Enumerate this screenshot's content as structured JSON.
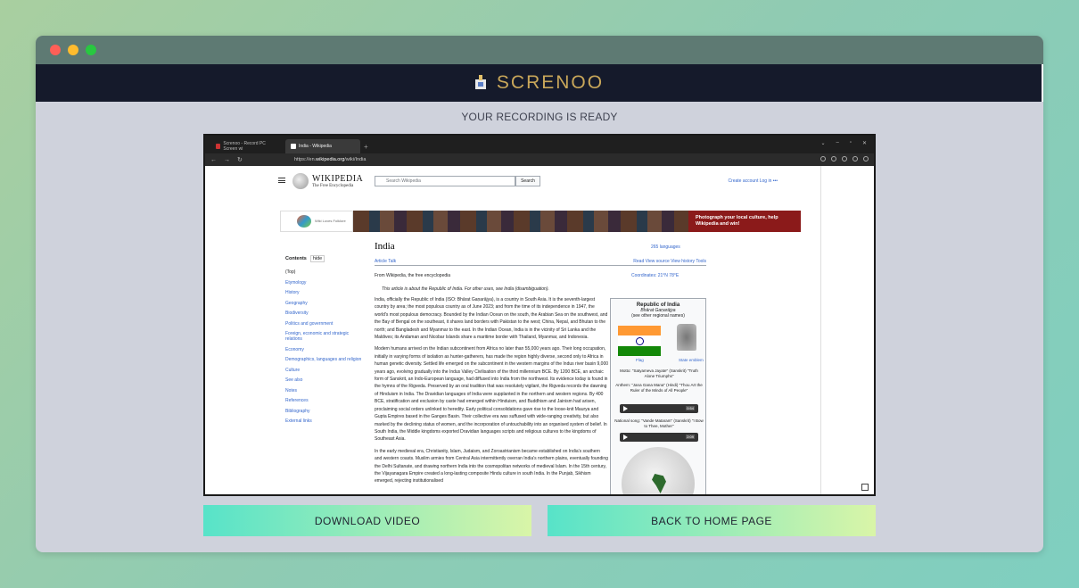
{
  "app": {
    "brand": "SCRENOO",
    "heading": "YOUR RECORDING IS READY"
  },
  "browser": {
    "tabs": [
      {
        "title": "Screnoo - Record PC Screen wi"
      },
      {
        "title": "India - Wikipedia"
      }
    ],
    "new_tab": "+",
    "url_prefix": "https://en.",
    "url_domain": "wikipedia.org",
    "url_path": "/wiki/India"
  },
  "wiki": {
    "logo_title": "WIKIPEDIA",
    "logo_sub": "The Free Encyclopedia",
    "search_placeholder": "Search Wikipedia",
    "search_button": "Search",
    "account": "Create account  Log in  •••",
    "banner_text": "Photograph your local culture, help Wikipedia and win!",
    "banner_logo_text": "Wiki Loves Folklore",
    "toc_title": "Contents",
    "toc_hide": "hide",
    "toc_items": [
      "(Top)",
      "Etymology",
      "History",
      "Geography",
      "Biodiversity",
      "Politics and government",
      "Foreign, economic and strategic relations",
      "Economy",
      "Demographics, languages and religion",
      "Culture",
      "See also",
      "Notes",
      "References",
      "Bibliography",
      "External links"
    ],
    "article_title": "India",
    "languages": "265 languages",
    "tabs_left": "Article   Talk",
    "tabs_right": "Read   View source   View history   Tools",
    "from": "From Wikipedia, the free encyclopedia",
    "coordinates": "Coordinates: 21°N 78°E",
    "hatnote": "This article is about the Republic of India. For other uses, see India (disambiguation).",
    "paragraphs": [
      "India, officially the Republic of India (ISO: Bhārat Gaṇarājya), is a country in South Asia. It is the seventh-largest country by area; the most populous country as of June 2023; and from the time of its independence in 1947, the world's most populous democracy. Bounded by the Indian Ocean on the south, the Arabian Sea on the southwest, and the Bay of Bengal on the southeast, it shares land borders with Pakistan to the west; China, Nepal, and Bhutan to the north; and Bangladesh and Myanmar to the east. In the Indian Ocean, India is in the vicinity of Sri Lanka and the Maldives; its Andaman and Nicobar Islands share a maritime border with Thailand, Myanmar, and Indonesia.",
      "Modern humans arrived on the Indian subcontinent from Africa no later than 55,000 years ago. Their long occupation, initially in varying forms of isolation as hunter-gatherers, has made the region highly diverse, second only to Africa in human genetic diversity. Settled life emerged on the subcontinent in the western margins of the Indus river basin 9,000 years ago, evolving gradually into the Indus Valley Civilisation of the third millennium BCE. By 1200 BCE, an archaic form of Sanskrit, an Indo-European language, had diffused into India from the northwest. Its evidence today is found in the hymns of the Rigveda. Preserved by an oral tradition that was resolutely vigilant, the Rigveda records the dawning of Hinduism in India. The Dravidian languages of India were supplanted in the northern and western regions. By 400 BCE, stratification and exclusion by caste had emerged within Hinduism, and Buddhism and Jainism had arisen, proclaiming social orders unlinked to heredity. Early political consolidations gave rise to the loose-knit Maurya and Gupta Empires based in the Ganges Basin. Their collective era was suffused with wide-ranging creativity, but also marked by the declining status of women, and the incorporation of untouchability into an organised system of belief. In South India, the Middle kingdoms exported Dravidian languages scripts and religious cultures to the kingdoms of Southeast Asia.",
      "In the early medieval era, Christianity, Islam, Judaism, and Zoroastrianism became established on India's southern and western coasts. Muslim armies from Central Asia intermittently overran India's northern plains, eventually founding the Delhi Sultanate, and drawing northern India into the cosmopolitan networks of medieval Islam. In the 15th century, the Vijayanagara Empire created a long-lasting composite Hindu culture in south India. In the Punjab, Sikhism emerged, rejecting institutionalised"
    ],
    "infobox": {
      "title": "Republic of India",
      "native": "Bhārat Gaṇarājya",
      "other_names": "(see other regional names)",
      "flag_label": "Flag",
      "emblem_label": "State emblem",
      "motto": "Motto: \"Satyameva Jayate\" (Sanskrit) \"Truth Alone Triumphs\"",
      "anthem": "Anthem: \"Jana Gana Mana\" (Hindi) \"Thou Art the Ruler of the Minds of All People\"",
      "anthem_time": "0:54",
      "song": "National song: \"Vande Mataram\" (Sanskrit) \"I Bow to Thee, Mother\"",
      "song_time": "2:09"
    }
  },
  "buttons": {
    "download": "DOWNLOAD VIDEO",
    "home": "BACK TO HOME PAGE"
  }
}
